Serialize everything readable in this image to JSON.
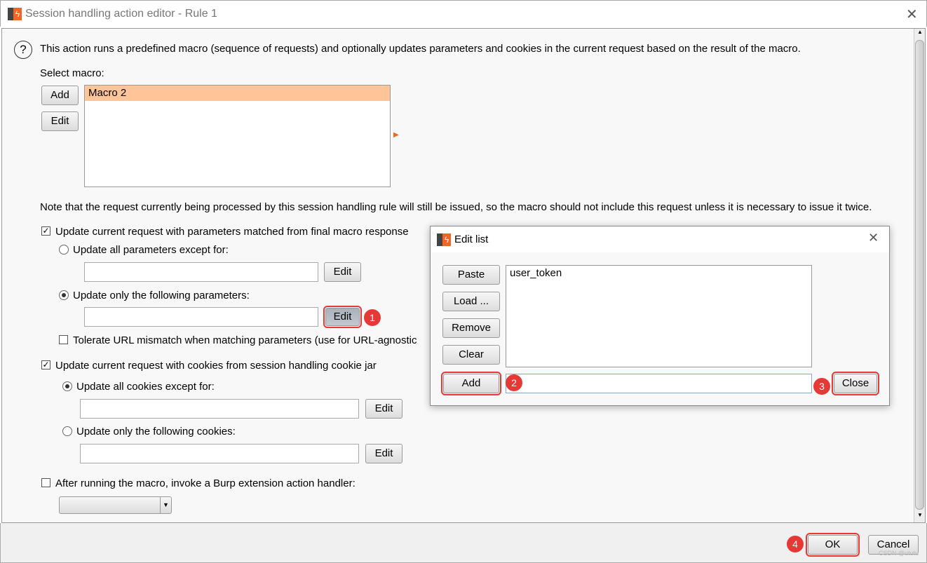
{
  "window": {
    "title": "Session handling action editor - Rule 1",
    "close": "✕"
  },
  "intro": "This action runs a predefined macro (sequence of requests) and optionally updates parameters and cookies in the current request based on the result of the macro.",
  "select_macro": {
    "label": "Select macro:",
    "add": "Add",
    "edit": "Edit",
    "items": [
      "Macro 2"
    ]
  },
  "note": "Note that the request currently being processed by this session handling rule will still be issued, so the macro should not include this request unless it is necessary to issue it twice.",
  "params": {
    "checkbox": "Update current request with parameters matched from final macro response",
    "checked": true,
    "opt_all": "Update all parameters except for:",
    "opt_only": "Update only the following parameters:",
    "selected": "only",
    "edit": "Edit",
    "tolerate": "Tolerate URL mismatch when matching parameters (use for URL-agnostic",
    "tolerate_checked": false
  },
  "cookies": {
    "checkbox": "Update current request with cookies from session handling cookie jar",
    "checked": true,
    "opt_all": "Update all cookies except for:",
    "opt_only": "Update only the following cookies:",
    "selected": "all",
    "edit": "Edit"
  },
  "extension": {
    "checkbox": "After running the macro, invoke a Burp extension action handler:",
    "checked": false,
    "value": ""
  },
  "footer": {
    "ok": "OK",
    "cancel": "Cancel",
    "watermark": "CSDN @ututu"
  },
  "edit_list": {
    "title": "Edit list",
    "close": "✕",
    "paste": "Paste",
    "load": "Load ...",
    "remove": "Remove",
    "clear": "Clear",
    "add": "Add",
    "close_btn": "Close",
    "items": [
      "user_token"
    ],
    "input": ""
  },
  "badges": [
    "1",
    "2",
    "3",
    "4"
  ],
  "colors": {
    "selection": "#ffc599",
    "highlight": "#e53935",
    "brand": "#f26522"
  }
}
